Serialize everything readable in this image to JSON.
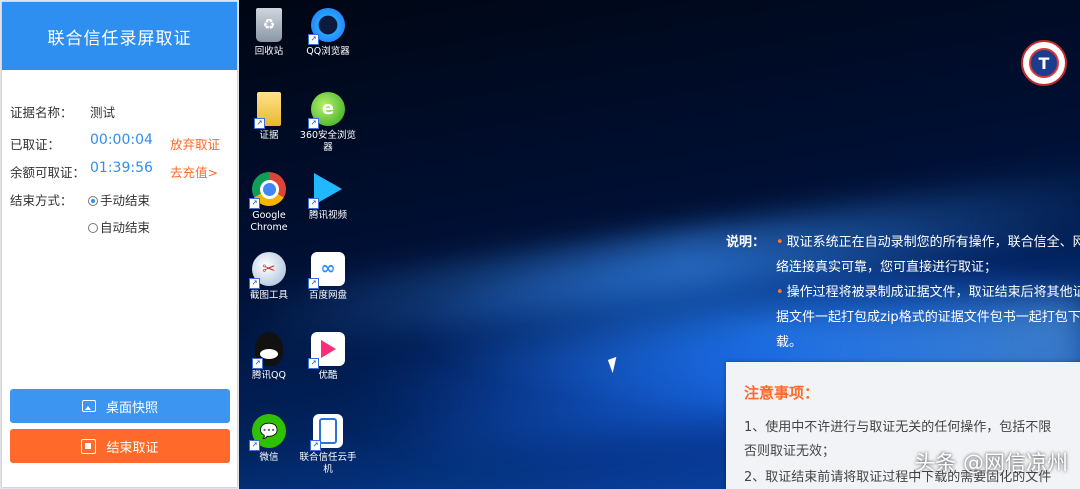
{
  "panel": {
    "title": "联合信任录屏取证",
    "evidence_name_label": "证据名称：",
    "evidence_name": "测试",
    "elapsed_label": "已取证：",
    "elapsed": "00:00:04",
    "abandon_link": "放弃取证",
    "remaining_label": "余额可取证：",
    "remaining": "01:39:56",
    "recharge_link": "去充值>",
    "end_mode_label": "结束方式：",
    "end_modes": [
      "手动结束",
      "自动结束"
    ],
    "selected_end_mode": "手动结束",
    "snapshot_button": "桌面快照",
    "end_button": "结束取证",
    "accent": "#2f8ff0",
    "warn": "#ff6a2b"
  },
  "desktop": {
    "icons": [
      {
        "label": "回收站",
        "icon": "recycle-bin-icon"
      },
      {
        "label": "QQ浏览器",
        "icon": "qq-browser-icon"
      },
      {
        "label": "证据",
        "icon": "folder-icon"
      },
      {
        "label": "360安全浏览器",
        "icon": "360-browser-icon"
      },
      {
        "label": "Google Chrome",
        "icon": "chrome-icon"
      },
      {
        "label": "腾讯视频",
        "icon": "tencent-video-icon"
      },
      {
        "label": "截图工具",
        "icon": "snipping-tool-icon"
      },
      {
        "label": "百度网盘",
        "icon": "baidu-netdisk-icon"
      },
      {
        "label": "腾讯QQ",
        "icon": "qq-penguin-icon"
      },
      {
        "label": "优酷",
        "icon": "youku-icon"
      },
      {
        "label": "微信",
        "icon": "wechat-icon"
      },
      {
        "label": "联合信任云手机",
        "icon": "cloud-phone-icon"
      }
    ],
    "explain_title": "说明：",
    "explain_items": [
      "取证系统正在自动录制您的所有操作，联合信全、网络连接真实可靠，您可直接进行取证；",
      "操作过程将被录制成证据文件，取证结束后将其他证据文件一起打包成zip格式的证据文件包书一起打包下载。"
    ],
    "notice_title": "注意事项：",
    "notice_lines": [
      "1、使用中不许进行与取证无关的任何操作，包括不限",
      "否则取证无效；",
      "2、取证结束前请将取证过程中下载的需要固化的文件"
    ],
    "watermark": "头条 @网信凉州"
  }
}
